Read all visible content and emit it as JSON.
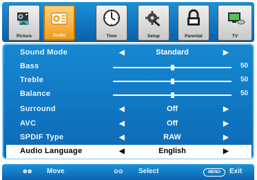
{
  "tabs": [
    {
      "label": "Picture",
      "icon": "picture-icon"
    },
    {
      "label": "Audio",
      "icon": "audio-icon"
    },
    {
      "label": "Time",
      "icon": "clock-icon"
    },
    {
      "label": "Setup",
      "icon": "wrench-gear-icon"
    },
    {
      "label": "Parental",
      "icon": "lock-icon"
    },
    {
      "label": "TV",
      "icon": "satellite-tv-icon"
    }
  ],
  "active_tab": "Audio",
  "menu": {
    "sound_mode": {
      "label": "Sound Mode",
      "value": "Standard"
    },
    "bass": {
      "label": "Bass",
      "value": "50",
      "level": 50
    },
    "treble": {
      "label": "Treble",
      "value": "50",
      "level": 50
    },
    "balance": {
      "label": "Balance",
      "value": "50",
      "level": 50
    },
    "surround": {
      "label": "Surround",
      "value": "Off"
    },
    "avc": {
      "label": "AVC",
      "value": "Off"
    },
    "spdif": {
      "label": "SPDIF Type",
      "value": "RAW"
    },
    "audio_language": {
      "label": "Audio Language",
      "value": "English"
    }
  },
  "footer": {
    "move": "Move",
    "select": "Select",
    "menu_key": "MENU",
    "exit": "Exit"
  },
  "colors": {
    "panel_blue": "#0d69b6",
    "active_tab": "#f29a18",
    "selection": "#ffffff"
  }
}
